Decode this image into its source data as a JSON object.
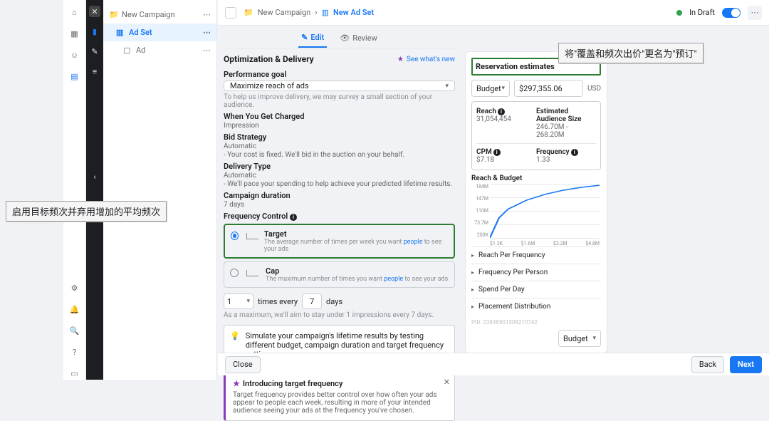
{
  "rails": {
    "dark_icons": [
      "close",
      "bar-chart",
      "pencil",
      "menu",
      "chevron-left"
    ]
  },
  "tree": {
    "campaign": "New Campaign",
    "adset": "Ad Set",
    "ad": "Ad"
  },
  "header": {
    "folder": "New Campaign",
    "current": "New Ad Set",
    "status": "In Draft"
  },
  "tabs": {
    "edit": "Edit",
    "review": "Review"
  },
  "whatsnew": "See what's new",
  "opt_delivery": {
    "heading": "Optimization & Delivery",
    "perf_goal_label": "Performance goal",
    "perf_goal_value": "Maximize reach of ads",
    "perf_goal_hint": "To help us improve delivery, we may survey a small section of your audience.",
    "charged_label": "When You Get Charged",
    "charged_value": "Impression",
    "bid_label": "Bid Strategy",
    "bid_value": "Automatic",
    "bid_hint": "- Your cost is fixed. We'll bid in the auction on your behalf.",
    "delivery_label": "Delivery Type",
    "delivery_value": "Automatic",
    "delivery_hint": "- We'll pace your spending to help achieve your predicted lifetime results.",
    "duration_label": "Campaign duration",
    "duration_value": "7 days",
    "freq_label": "Frequency Control",
    "target": {
      "title": "Target",
      "desc_pre": "The average number of times per week you want ",
      "desc_link": "people",
      "desc_post": " to see your ads"
    },
    "cap": {
      "title": "Cap",
      "desc_pre": "The maximum number of times you want ",
      "desc_link": "people",
      "desc_post": " to see your ads"
    },
    "freq_inputs": {
      "times": "1",
      "times_label": "times every",
      "every_n": "7",
      "days_label": "days"
    },
    "freq_hint": "As a maximum, we'll aim to stay under 1 impressions every 7 days.",
    "sim": "Simulate your campaign's lifetime results by testing different budget, campaign duration and target frequency settings.",
    "intro": {
      "title": "Introducing target frequency",
      "body": "Target frequency provides better control over how often your ads appear to people each week, resulting in more of your intended audience seeing your ads at the frequency you've chosen."
    }
  },
  "side": {
    "title": "Reservation estimates",
    "budget_label": "Budget",
    "budget_value": "$297,355.06",
    "currency": "USD",
    "metrics": {
      "reach_label": "Reach",
      "reach_value": "31,054,454",
      "aud_label": "Estimated Audience Size",
      "aud_value": "246.70M - 268.20M",
      "cpm_label": "CPM",
      "cpm_value": "$7.18",
      "freq_label": "Frequency",
      "freq_value": "1.33"
    },
    "chart_label": "Reach & Budget",
    "accordions": [
      "Reach Per Frequency",
      "Frequency Per Person",
      "Spend Per Day",
      "Placement Distribution"
    ],
    "pid": "PID: 23848501309210742",
    "footer_select": "Budget"
  },
  "bottom": {
    "close": "Close",
    "back": "Back",
    "next": "Next"
  },
  "annotations": {
    "left": "启用目标频次并弃用增加的平均频次",
    "right": "将\"覆盖和频次出价\"更名为\"预订\""
  },
  "chart_data": {
    "type": "line",
    "title": "Reach & Budget",
    "xlabel": "Budget",
    "ylabel": "Reach",
    "ylim": [
      0,
      184000000
    ],
    "xlim": [
      1300,
      4800000
    ],
    "y_ticks": [
      "184M",
      "147M",
      "110M",
      "73.7M",
      "200K"
    ],
    "x_ticks": [
      "$1.3K",
      "$1.6M",
      "$3.2M",
      "$4.8M"
    ],
    "x": [
      1300,
      400000,
      800000,
      1600000,
      2400000,
      3200000,
      4000000,
      4800000
    ],
    "values": [
      200000,
      68000000,
      98000000,
      128000000,
      148000000,
      162000000,
      172000000,
      179000000
    ]
  }
}
